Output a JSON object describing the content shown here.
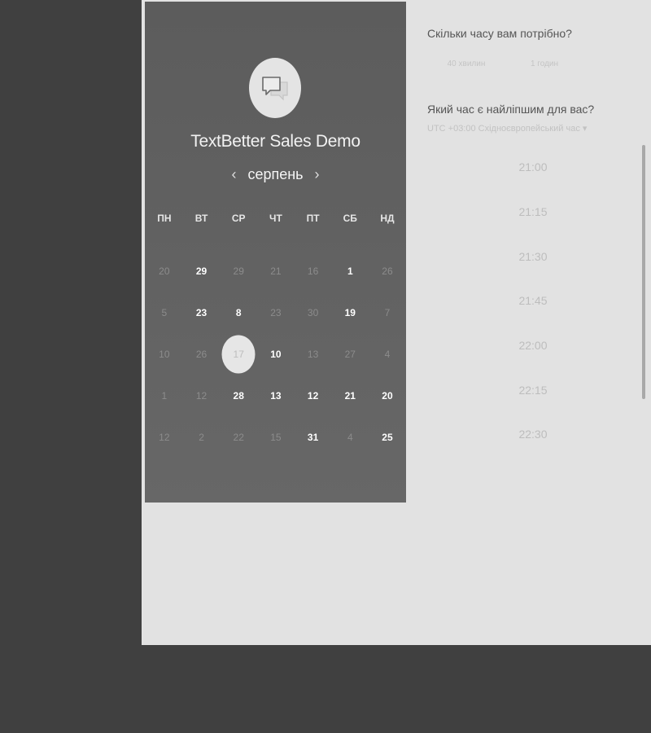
{
  "calendar": {
    "title": "TextBetter Sales Demo",
    "month": "серпень",
    "prev_icon": "‹",
    "next_icon": "›",
    "weekdays": [
      "ПН",
      "ВТ",
      "СР",
      "ЧТ",
      "ПТ",
      "СБ",
      "НД"
    ],
    "days": [
      {
        "label": "20",
        "active": false
      },
      {
        "label": "29",
        "active": true
      },
      {
        "label": "29",
        "active": false
      },
      {
        "label": "21",
        "active": false
      },
      {
        "label": "16",
        "active": false
      },
      {
        "label": "1",
        "active": true
      },
      {
        "label": "26",
        "active": false
      },
      {
        "label": "5",
        "active": false
      },
      {
        "label": "23",
        "active": true
      },
      {
        "label": "8",
        "active": true
      },
      {
        "label": "23",
        "active": false
      },
      {
        "label": "30",
        "active": false
      },
      {
        "label": "19",
        "active": true
      },
      {
        "label": "7",
        "active": false
      },
      {
        "label": "10",
        "active": false
      },
      {
        "label": "26",
        "active": false
      },
      {
        "label": "17",
        "active": false,
        "selected": true
      },
      {
        "label": "10",
        "active": true
      },
      {
        "label": "13",
        "active": false
      },
      {
        "label": "27",
        "active": false
      },
      {
        "label": "4",
        "active": false
      },
      {
        "label": "1",
        "active": false
      },
      {
        "label": "12",
        "active": false
      },
      {
        "label": "28",
        "active": true
      },
      {
        "label": "13",
        "active": true
      },
      {
        "label": "12",
        "active": true
      },
      {
        "label": "21",
        "active": true
      },
      {
        "label": "20",
        "active": true
      },
      {
        "label": "12",
        "active": false
      },
      {
        "label": "2",
        "active": false
      },
      {
        "label": "22",
        "active": false
      },
      {
        "label": "15",
        "active": false
      },
      {
        "label": "31",
        "active": true
      },
      {
        "label": "4",
        "active": false
      },
      {
        "label": "25",
        "active": true
      }
    ]
  },
  "booking": {
    "duration_question": "Скільки часу вам потрібно?",
    "durations": [
      "40 хвилин",
      "1 годин"
    ],
    "time_question": "Який час є найліпшим для вас?",
    "timezone": "UTC +03:00 Східноєвропейський час ▾",
    "slots": [
      "21:00",
      "21:15",
      "21:30",
      "21:45",
      "22:00",
      "22:15",
      "22:30"
    ]
  },
  "colors": {
    "calendar_bg": "#606060",
    "page_bg": "#e2e2e2",
    "backdrop": "#404040"
  }
}
